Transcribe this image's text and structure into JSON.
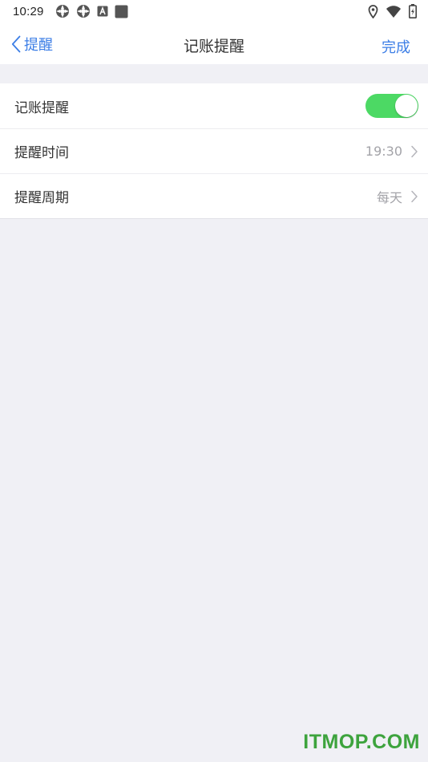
{
  "status_bar": {
    "time": "10:29",
    "left_icons": [
      "aperture-icon",
      "aperture-icon",
      "a-badge-icon",
      "square-icon"
    ],
    "right_icons": [
      "location-pin-icon",
      "wifi-icon",
      "battery-charging-icon"
    ]
  },
  "nav": {
    "back_label": "提醒",
    "title": "记账提醒",
    "done_label": "完成"
  },
  "settings": {
    "reminder_label": "记账提醒",
    "reminder_enabled": true,
    "time_label": "提醒时间",
    "time_value": "19:30",
    "cycle_label": "提醒周期",
    "cycle_value": "每天"
  },
  "watermark": "ITMOP.COM",
  "colors": {
    "accent": "#3c7ee6",
    "toggle_on": "#4cd964",
    "background": "#f0f0f5",
    "watermark": "#3da33d"
  }
}
